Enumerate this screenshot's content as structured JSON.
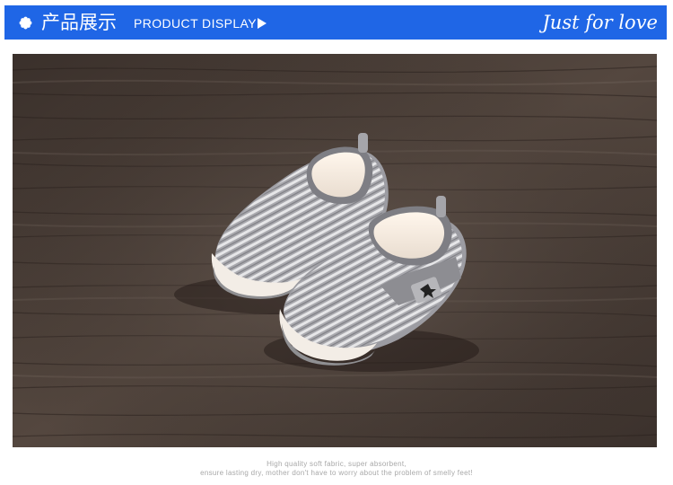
{
  "header": {
    "title_cn": "产品展示",
    "title_en": "PRODUCT DISPLAY",
    "tagline": "Just for love",
    "bullet_icon": "flower-bullet-icon",
    "arrow_icon": "play-arrow-icon",
    "bar_color": "#1f66e6",
    "text_color": "#ffffff"
  },
  "photo": {
    "subject": "pair of grey knit baby shoes on dark wood"
  },
  "caption": {
    "line1": "High quality soft fabric, super absorbent,",
    "line2": "ensure lasting dry, mother don't have to worry about the problem of smelly feet!"
  }
}
